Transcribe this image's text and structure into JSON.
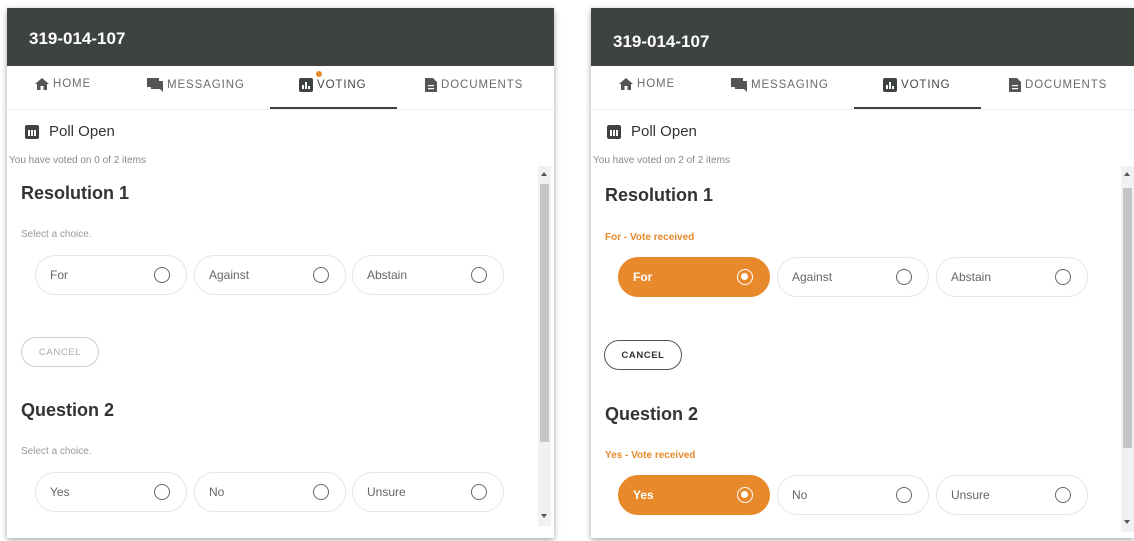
{
  "colors": {
    "header_bg": "#3e4340",
    "accent": "#e8892b"
  },
  "panels": [
    {
      "meeting_id": "319-014-107",
      "nav": [
        {
          "label": "HOME",
          "icon": "home-icon"
        },
        {
          "label": "MESSAGING",
          "icon": "messaging-icon"
        },
        {
          "label": "VOTING",
          "icon": "voting-icon",
          "active": true,
          "notification": true
        },
        {
          "label": "DOCUMENTS",
          "icon": "documents-icon"
        }
      ],
      "poll_title": "Poll Open",
      "voted_count": "You have voted on 0 of 2 items",
      "items": [
        {
          "title": "Resolution 1",
          "status": "Select a choice.",
          "choices": [
            "For",
            "Against",
            "Abstain"
          ],
          "selected": null,
          "cancel": "CANCEL"
        },
        {
          "title": "Question 2",
          "status": "Select a choice.",
          "choices": [
            "Yes",
            "No",
            "Unsure"
          ],
          "selected": null
        }
      ]
    },
    {
      "meeting_id": "319-014-107",
      "nav": [
        {
          "label": "HOME",
          "icon": "home-icon"
        },
        {
          "label": "MESSAGING",
          "icon": "messaging-icon"
        },
        {
          "label": "VOTING",
          "icon": "voting-icon",
          "active": true
        },
        {
          "label": "DOCUMENTS",
          "icon": "documents-icon"
        }
      ],
      "poll_title": "Poll Open",
      "voted_count": "You have voted on 2 of 2 items",
      "items": [
        {
          "title": "Resolution 1",
          "status": "For - Vote received",
          "choices": [
            "For",
            "Against",
            "Abstain"
          ],
          "selected": "For",
          "cancel": "CANCEL"
        },
        {
          "title": "Question 2",
          "status": "Yes - Vote received",
          "choices": [
            "Yes",
            "No",
            "Unsure"
          ],
          "selected": "Yes"
        }
      ]
    }
  ]
}
